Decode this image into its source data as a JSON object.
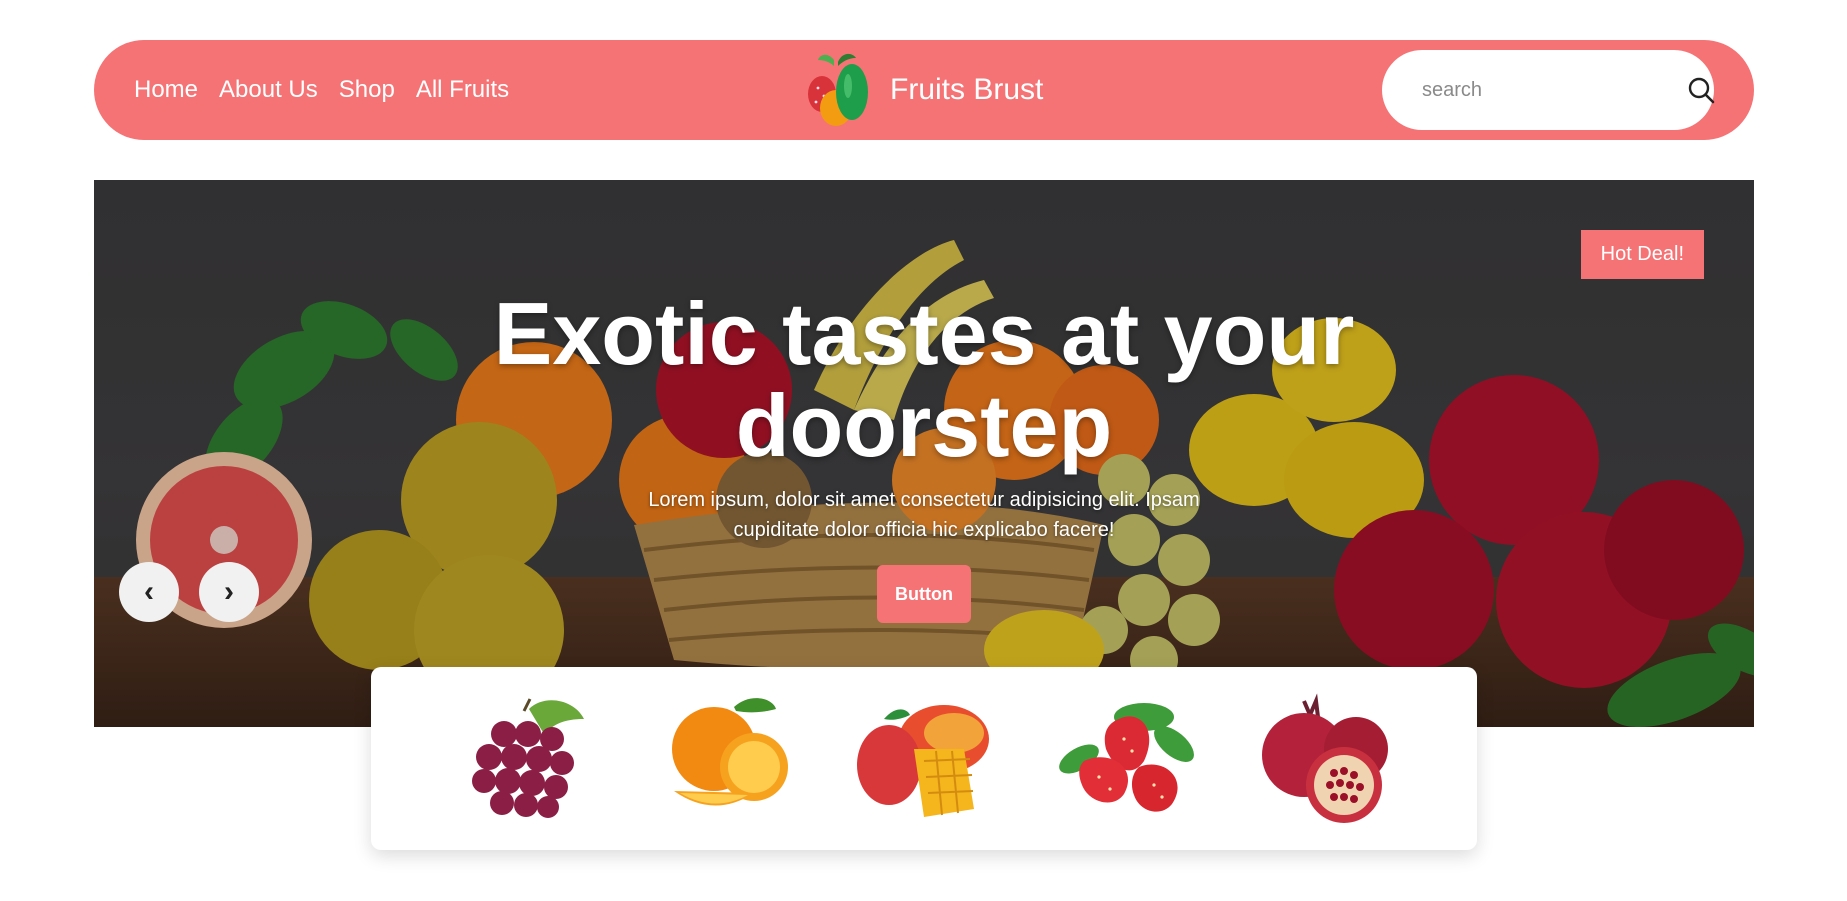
{
  "nav": {
    "links": [
      "Home",
      "About Us",
      "Shop",
      "All Fruits"
    ],
    "brand_name": "Fruits Brust",
    "search_placeholder": "search"
  },
  "hero": {
    "badge": "Hot Deal!",
    "title": "Exotic tastes at your doorstep",
    "description": "Lorem ipsum, dolor sit amet consectetur adipisicing elit. Ipsam cupiditate dolor officia hic explicabo facere!",
    "button_label": "Button",
    "prev_arrow": "‹",
    "next_arrow": "›"
  },
  "fruits": [
    {
      "name": "grapes-icon"
    },
    {
      "name": "orange-icon"
    },
    {
      "name": "mango-icon"
    },
    {
      "name": "strawberry-icon"
    },
    {
      "name": "pomegranate-icon"
    }
  ],
  "colors": {
    "accent": "#f67375",
    "white": "#ffffff"
  }
}
